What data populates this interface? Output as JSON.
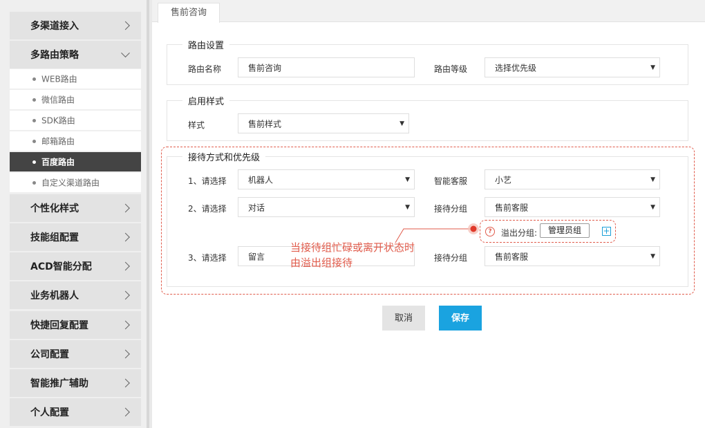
{
  "sidebar": {
    "menu": [
      {
        "label": "多渠道接入"
      },
      {
        "label": "多路由策略"
      },
      {
        "label": "个性化样式"
      },
      {
        "label": "技能组配置"
      },
      {
        "label": "ACD智能分配"
      },
      {
        "label": "业务机器人"
      },
      {
        "label": "快捷回复配置"
      },
      {
        "label": "公司配置"
      },
      {
        "label": "智能推广辅助"
      },
      {
        "label": "个人配置"
      }
    ],
    "submenu": [
      {
        "label": "WEB路由"
      },
      {
        "label": "微信路由"
      },
      {
        "label": "SDK路由"
      },
      {
        "label": "邮箱路由"
      },
      {
        "label": "百度路由"
      },
      {
        "label": "自定义渠道路由"
      }
    ]
  },
  "tab": {
    "label": "售前咨询"
  },
  "routing": {
    "legend": "路由设置",
    "name_label": "路由名称",
    "name_value": "售前咨询",
    "level_label": "路由等级",
    "level_value": "选择优先级"
  },
  "style_section": {
    "legend": "启用样式",
    "style_label": "样式",
    "style_value": "售前样式"
  },
  "priority": {
    "legend": "接待方式和优先级",
    "rows": [
      {
        "label": "1、请选择",
        "value": "机器人",
        "right_label": "智能客服",
        "right_value": "小艺"
      },
      {
        "label": "2、请选择",
        "value": "对话",
        "right_label": "接待分组",
        "right_value": "售前客服"
      },
      {
        "label": "3、请选择",
        "value": "留言",
        "right_label": "接待分组",
        "right_value": "售前客服"
      }
    ],
    "overflow_label": "溢出分组:",
    "overflow_tag": "管理员组",
    "help_glyph": "?",
    "add_glyph": "+",
    "note_line1": "当接待组忙碌或离开状态时",
    "note_line2": "由溢出组接待",
    "accent_color": "#e05a4a"
  },
  "actions": {
    "cancel": "取消",
    "save": "保存",
    "save_color": "#1aa3e0"
  },
  "icons": {
    "dropdown": "▼"
  }
}
